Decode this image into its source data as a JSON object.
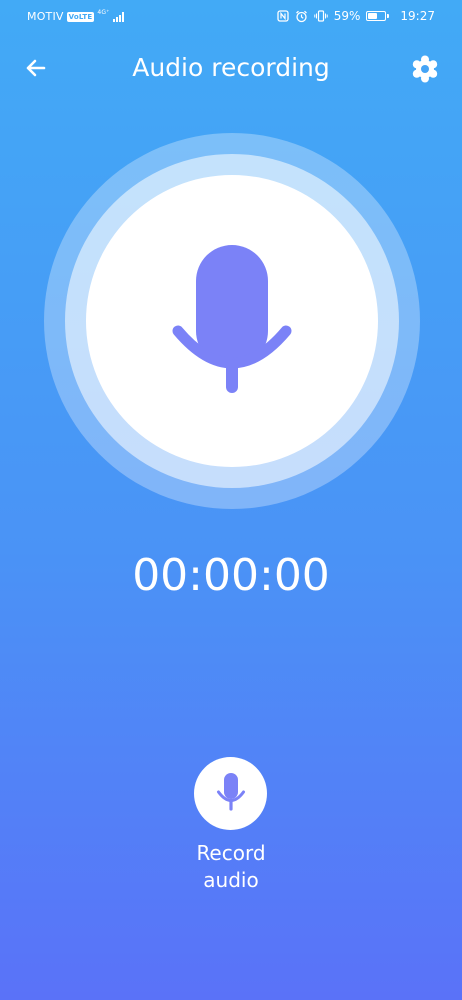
{
  "status_bar": {
    "carrier": "MOTIV",
    "volte": "VoLTE",
    "network": "4G⁺",
    "battery_percent": "59%",
    "battery_level": 0.59,
    "time": "19:27"
  },
  "header": {
    "title": "Audio recording",
    "back_icon": "arrow-left-icon",
    "settings_icon": "gear-icon"
  },
  "recorder": {
    "timer": "00:00:00",
    "record_label": "Record audio",
    "mic_icon": "microphone-icon"
  },
  "colors": {
    "background_top": "#42aaf6",
    "background_bottom": "#5a72f8",
    "mic_accent": "#7b82f7",
    "text": "#ffffff"
  }
}
